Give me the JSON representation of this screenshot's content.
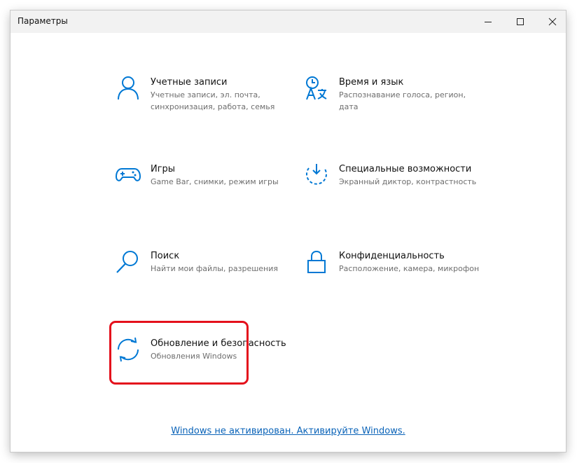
{
  "window": {
    "title": "Параметры"
  },
  "tiles": [
    {
      "title": "Учетные записи",
      "subtitle": "Учетные записи, эл. почта, синхронизация, работа, семья",
      "icon": "person-icon"
    },
    {
      "title": "Время и язык",
      "subtitle": "Распознавание голоса, регион, дата",
      "icon": "time-language-icon"
    },
    {
      "title": "Игры",
      "subtitle": "Game Bar, снимки, режим игры",
      "icon": "gamepad-icon"
    },
    {
      "title": "Специальные возможности",
      "subtitle": "Экранный диктор, контрастность",
      "icon": "ease-of-access-icon"
    },
    {
      "title": "Поиск",
      "subtitle": "Найти мои файлы, разрешения",
      "icon": "search-icon"
    },
    {
      "title": "Конфиденциальность",
      "subtitle": "Расположение, камера, микрофон",
      "icon": "lock-icon"
    },
    {
      "title": "Обновление и безопасность",
      "subtitle": "Обновления Windows",
      "icon": "sync-icon"
    }
  ],
  "activation_link": "Windows не активирован. Активируйте Windows.",
  "colors": {
    "accent": "#0078d4",
    "highlight": "#e4101c",
    "link": "#0a63b8"
  }
}
